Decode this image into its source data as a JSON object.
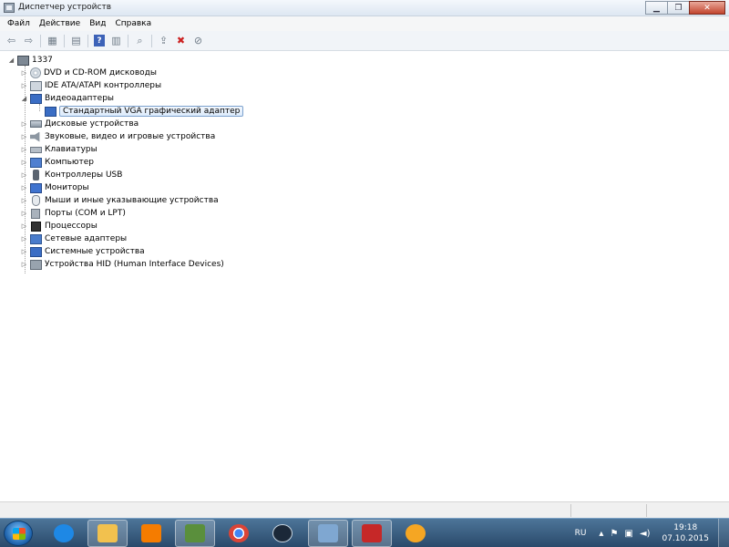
{
  "window": {
    "title": "Диспетчер устройств",
    "minimize_glyph": "▁",
    "maximize_glyph": "❐",
    "close_glyph": "✕"
  },
  "menu": [
    "Файл",
    "Действие",
    "Вид",
    "Справка"
  ],
  "toolbar": {
    "icons": [
      "back-icon",
      "forward-icon",
      "show-hide-tree-icon",
      "properties-icon",
      "help-icon",
      "view-icon",
      "scan-hardware-icon",
      "update-driver-icon",
      "uninstall-icon",
      "disable-icon"
    ],
    "back_glyph": "⇦",
    "forward_glyph": "⇨",
    "help_glyph": "?"
  },
  "tree": {
    "root": "1337",
    "categories": [
      {
        "label": "DVD и CD-ROM дисководы",
        "icon": "dvd-icon"
      },
      {
        "label": "IDE ATA/ATAPI контроллеры",
        "icon": "ide-controller-icon"
      },
      {
        "label": "Видеоадаптеры",
        "icon": "display-adapter-icon",
        "expanded": true,
        "children": [
          {
            "label": "Стандартный VGA графический адаптер",
            "selected": true
          }
        ]
      },
      {
        "label": "Дисковые устройства",
        "icon": "disk-drive-icon"
      },
      {
        "label": "Звуковые, видео и игровые устройства",
        "icon": "sound-icon"
      },
      {
        "label": "Клавиатуры",
        "icon": "keyboard-icon"
      },
      {
        "label": "Компьютер",
        "icon": "computer-icon"
      },
      {
        "label": "Контроллеры USB",
        "icon": "usb-icon"
      },
      {
        "label": "Мониторы",
        "icon": "monitor-icon"
      },
      {
        "label": "Мыши и иные указывающие устройства",
        "icon": "mouse-icon"
      },
      {
        "label": "Порты (COM и LPT)",
        "icon": "port-icon"
      },
      {
        "label": "Процессоры",
        "icon": "processor-icon"
      },
      {
        "label": "Сетевые адаптеры",
        "icon": "network-adapter-icon"
      },
      {
        "label": "Системные устройства",
        "icon": "system-devices-icon"
      },
      {
        "label": "Устройства HID (Human Interface Devices)",
        "icon": "hid-icon"
      }
    ]
  },
  "taskbar": {
    "apps": [
      "internet-explorer-icon",
      "file-explorer-icon",
      "media-player-icon",
      "system-monitor-icon",
      "chrome-icon",
      "steam-icon",
      "device-manager-icon",
      "toolbox-icon",
      "app-icon"
    ],
    "language": "RU",
    "time": "19:18",
    "date": "07.10.2015",
    "colors": {
      "ie": "#1e88e5",
      "explorer": "#f2c14e",
      "media": "#f57c00",
      "monitor": "#5a8f3c",
      "chrome": "#db4437",
      "steam": "#1b2838",
      "devmgr": "#7fa7d1",
      "toolbox": "#c62828",
      "app": "#f5a623"
    }
  }
}
